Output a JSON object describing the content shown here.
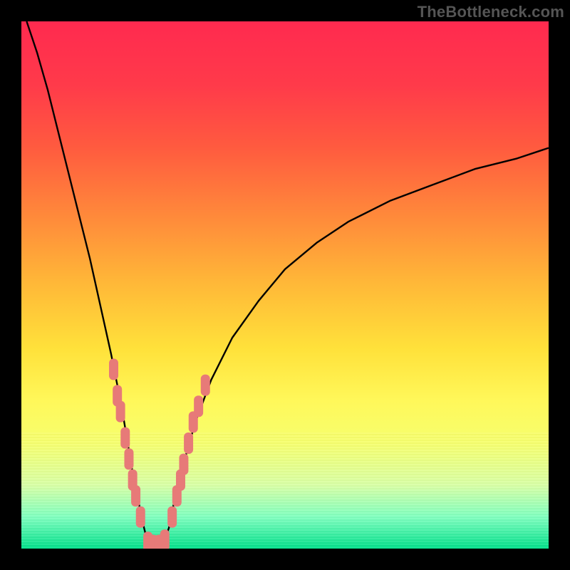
{
  "watermark": "TheBottleneck.com",
  "colors": {
    "frame": "#000000",
    "gradient_stops": [
      "#ff2a4f",
      "#ff3a4a",
      "#ff5b3f",
      "#ff8d3a",
      "#ffb938",
      "#ffe13a",
      "#fff85a",
      "#f6ff6e",
      "#d8ffa5",
      "#7fffbf",
      "#00e08a"
    ],
    "curve": "#000000",
    "marker": "#e77a78"
  },
  "chart_data": {
    "type": "line",
    "title": "",
    "xlabel": "",
    "ylabel": "",
    "xlim": [
      0,
      100
    ],
    "ylim": [
      0,
      100
    ],
    "grid": false,
    "legend": false,
    "series": [
      {
        "name": "bottleneck-curve",
        "x": [
          1,
          3,
          5,
          7,
          9,
          11,
          13,
          15,
          17,
          18,
          19,
          20,
          21,
          22,
          23,
          24,
          25,
          26,
          27,
          28,
          29,
          31,
          33,
          36,
          40,
          45,
          50,
          56,
          62,
          70,
          78,
          86,
          94,
          100
        ],
        "y": [
          100,
          94,
          87,
          79,
          71,
          63,
          55,
          46,
          37,
          32,
          27,
          21,
          15,
          10,
          5,
          1,
          0,
          0,
          1,
          4,
          9,
          17,
          24,
          32,
          40,
          47,
          53,
          58,
          62,
          66,
          69,
          72,
          74,
          76
        ]
      }
    ],
    "markers": {
      "name": "sample-points",
      "color": "#e77a78",
      "shape": "rounded-bar",
      "points": [
        {
          "x": 17.5,
          "y": 34
        },
        {
          "x": 18.2,
          "y": 29
        },
        {
          "x": 18.8,
          "y": 26
        },
        {
          "x": 19.7,
          "y": 21
        },
        {
          "x": 20.4,
          "y": 17
        },
        {
          "x": 21.1,
          "y": 13
        },
        {
          "x": 21.7,
          "y": 10
        },
        {
          "x": 22.6,
          "y": 6
        },
        {
          "x": 24.0,
          "y": 1.2
        },
        {
          "x": 25.0,
          "y": 0.6
        },
        {
          "x": 26.1,
          "y": 0.6
        },
        {
          "x": 27.2,
          "y": 1.6
        },
        {
          "x": 28.6,
          "y": 6
        },
        {
          "x": 29.5,
          "y": 10
        },
        {
          "x": 30.2,
          "y": 13
        },
        {
          "x": 30.8,
          "y": 16
        },
        {
          "x": 31.7,
          "y": 20
        },
        {
          "x": 32.6,
          "y": 24
        },
        {
          "x": 33.6,
          "y": 27
        },
        {
          "x": 34.9,
          "y": 31
        }
      ]
    }
  }
}
